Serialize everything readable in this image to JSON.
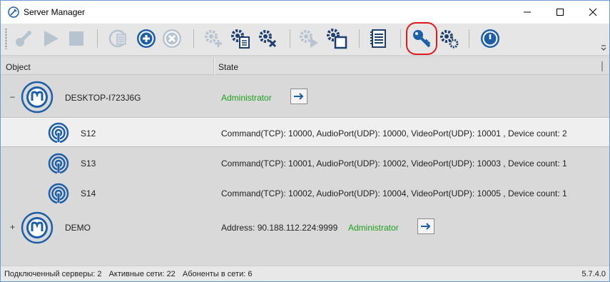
{
  "window": {
    "title": "Server Manager"
  },
  "toolbar": {
    "buttons": [
      {
        "name": "connect-icon",
        "state": "disabled"
      },
      {
        "name": "play-icon",
        "state": "disabled"
      },
      {
        "name": "stop-icon",
        "state": "disabled"
      },
      {
        "name": "copy-icon",
        "state": "disabled"
      },
      {
        "name": "add-icon",
        "state": "enabled"
      },
      {
        "name": "remove-icon",
        "state": "disabled"
      },
      {
        "name": "settings-add-icon",
        "state": "disabled"
      },
      {
        "name": "settings-list-icon",
        "state": "enabled"
      },
      {
        "name": "settings-remove-icon",
        "state": "enabled"
      },
      {
        "name": "settings-play-icon",
        "state": "disabled"
      },
      {
        "name": "settings-window-icon",
        "state": "enabled"
      },
      {
        "name": "log-icon",
        "state": "enabled"
      },
      {
        "name": "key-icon",
        "state": "enabled",
        "highlighted": true
      },
      {
        "name": "server-settings-icon",
        "state": "enabled"
      },
      {
        "name": "power-icon",
        "state": "enabled"
      }
    ]
  },
  "columns": {
    "object": "Object",
    "state": "State"
  },
  "servers": [
    {
      "expander": "–",
      "name": "DESKTOP-I723J6G",
      "role": "Administrator",
      "children": [
        {
          "name": "S12",
          "state": "Command(TCP): 10000, AudioPort(UDP): 10000, VideoPort(UDP): 10001 , Device count: 2",
          "selected": true
        },
        {
          "name": "S13",
          "state": "Command(TCP): 10001, AudioPort(UDP): 10002, VideoPort(UDP): 10003 , Device count: 1",
          "selected": false
        },
        {
          "name": "S14",
          "state": "Command(TCP): 10002, AudioPort(UDP): 10004, VideoPort(UDP): 10005 , Device count: 1",
          "selected": false
        }
      ]
    },
    {
      "expander": "+",
      "name": "DEMO",
      "address": "Address: 90.188.112.224:9999",
      "role": "Administrator"
    }
  ],
  "status": {
    "connected_servers": "Подключенный серверы: 2",
    "active_networks": "Активные сети: 22",
    "online_subscribers": "Абоненты в сети: 6",
    "version": "5.7.4.0"
  },
  "colors": {
    "accent_blue": "#1e5fa8",
    "admin_green": "#20a020",
    "highlight_red": "#e0191d"
  }
}
